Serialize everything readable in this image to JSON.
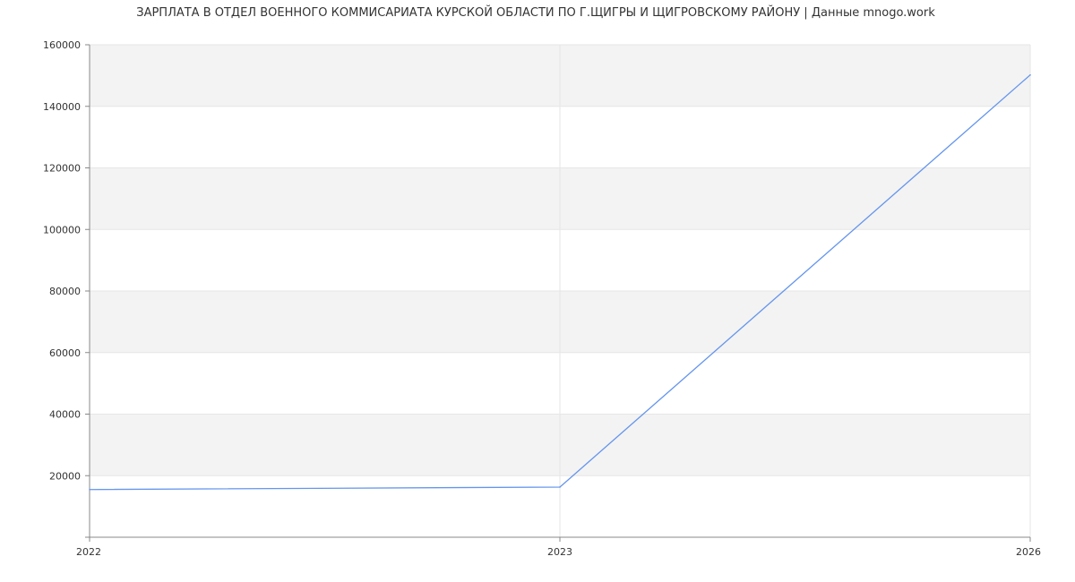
{
  "chart_data": {
    "type": "line",
    "title": "ЗАРПЛАТА В ОТДЕЛ ВОЕННОГО КОММИСАРИАТА КУРСКОЙ ОБЛАСТИ ПО Г.ЩИГРЫ И ЩИГРОВСКОМУ РАЙОНУ | Данные mnogo.work",
    "xlabel": "",
    "ylabel": "",
    "x_categories": [
      "2022",
      "2023",
      "2026"
    ],
    "series": [
      {
        "values": [
          15500,
          16300,
          150200
        ]
      }
    ],
    "ylim": [
      0,
      160000
    ],
    "y_ticks": [
      20000,
      40000,
      60000,
      80000,
      100000,
      120000,
      140000,
      160000
    ],
    "grid": true,
    "legend": "none",
    "line_color": "#6495ed",
    "band_color": "#f3f3f3"
  }
}
